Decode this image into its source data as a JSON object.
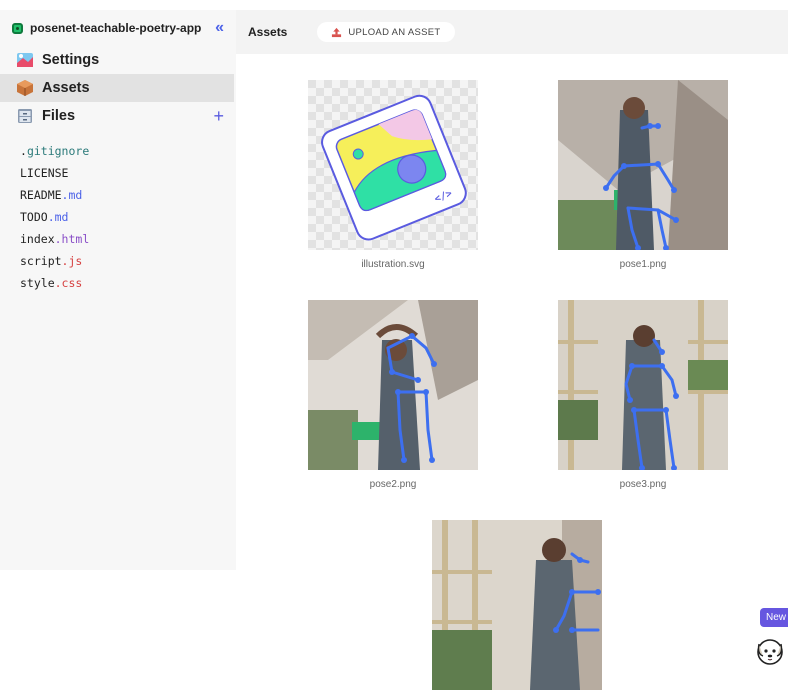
{
  "project": {
    "name": "posenet-teachable-poetry-app",
    "collapse_glyph": "«"
  },
  "nav": {
    "settings": {
      "label": "Settings",
      "icon": "settings-art-icon"
    },
    "assets": {
      "label": "Assets",
      "icon": "package-box-icon"
    },
    "files": {
      "label": "Files",
      "icon": "file-cabinet-icon",
      "add_glyph": "+"
    }
  },
  "files": [
    {
      "name": ".",
      "ext": "gitignore",
      "ext_class": "ext-gi"
    },
    {
      "name": "LICENSE",
      "ext": "",
      "ext_class": ""
    },
    {
      "name": "README",
      "ext": ".md",
      "ext_class": "ext-md"
    },
    {
      "name": "TODO",
      "ext": ".md",
      "ext_class": "ext-md"
    },
    {
      "name": "index",
      "ext": ".html",
      "ext_class": "ext-html"
    },
    {
      "name": "script",
      "ext": ".js",
      "ext_class": "ext-js"
    },
    {
      "name": "style",
      "ext": ".css",
      "ext_class": "ext-css"
    }
  ],
  "tabbar": {
    "tab": "Assets",
    "upload_label": "UPLOAD AN ASSET"
  },
  "assets": [
    {
      "caption": "illustration.svg"
    },
    {
      "caption": "pose1.png"
    },
    {
      "caption": "pose2.png"
    },
    {
      "caption": "pose3.png"
    },
    {
      "caption": ""
    }
  ],
  "badge": {
    "label": "New"
  },
  "colors": {
    "accent": "#4c62e8",
    "skeleton": "#3d6ff0",
    "badge": "#6656e0"
  }
}
